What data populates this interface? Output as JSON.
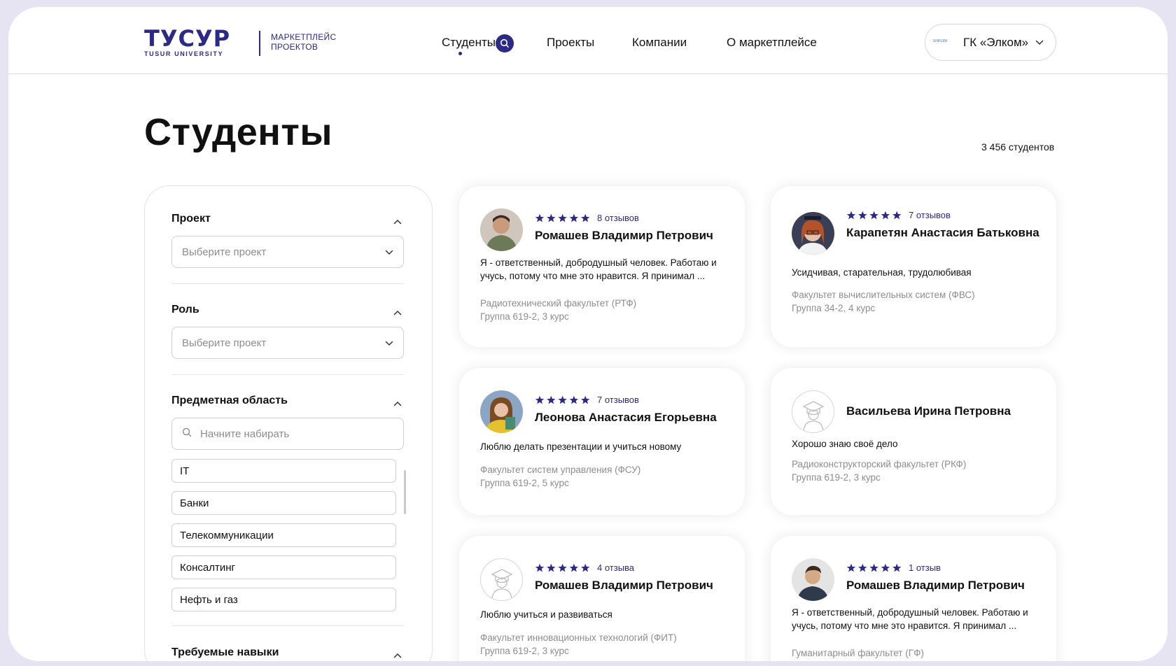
{
  "header": {
    "logo_main": "ТУСУР",
    "logo_sub": "TUSUR UNIVERSITY",
    "logo_tag_1": "Маркетплейс",
    "logo_tag_2": "проектов",
    "nav": [
      "Студенты",
      "Проекты",
      "Компании",
      "О маркетплейсе"
    ],
    "company_logo_text": "ЭЛКОМ",
    "company_name": "ГК «Элком»"
  },
  "page": {
    "title": "Студенты",
    "count": "3 456 студентов"
  },
  "filters": {
    "project_title": "Проект",
    "project_placeholder": "Выберите проект",
    "role_title": "Роль",
    "role_placeholder": "Выберите проект",
    "domain_title": "Предметная область",
    "domain_search_placeholder": "Начните набирать",
    "domain_options": [
      "IT",
      "Банки",
      "Телекоммуникации",
      "Консалтинг",
      "Нефть и газ"
    ],
    "skills_title": "Требуемые навыки"
  },
  "students": [
    {
      "rating": 5,
      "reviews": "8 отзывов",
      "name": "Ромашев Владимир Петрович",
      "desc": "Я - ответственный, добродушный человек. Работаю и учусь, потому что мне это нравится. Я принимал ...",
      "faculty": "Радиотехнический факультет (РТФ)",
      "group": "Группа 619-2, 3 курс",
      "avatar": "photo"
    },
    {
      "rating": 5,
      "reviews": "7 отзывов",
      "name": "Карапетян Анастасия Батьковна",
      "desc": "Усидчивая, старательная, трудолюбивая",
      "faculty": "Факультет вычислительных систем (ФВС)",
      "group": "Группа 34-2, 4 курс",
      "avatar": "photo"
    },
    {
      "rating": 5,
      "reviews": "7 отзывов",
      "name": "Леонова Анастасия Егорьевна",
      "desc": "Люблю делать презентации и учиться новому",
      "faculty": "Факультет систем управления (ФСУ)",
      "group": "Группа 619-2, 5 курс",
      "avatar": "photo"
    },
    {
      "rating": 0,
      "reviews": "",
      "name": "Васильева Ирина Петровна",
      "desc": "Хорошо знаю своё дело",
      "faculty": "Радиоконструкторский факультет (РКФ)",
      "group": "Группа 619-2, 3 курс",
      "avatar": "placeholder"
    },
    {
      "rating": 5,
      "reviews": "4 отзыва",
      "name": "Ромашев Владимир Петрович",
      "desc": "Люблю учиться и развиваться",
      "faculty": "Факультет инновационных технологий (ФИТ)",
      "group": "Группа 619-2, 3 курс",
      "avatar": "placeholder"
    },
    {
      "rating": 5,
      "reviews": "1 отзыв",
      "name": "Ромашев Владимир Петрович",
      "desc": "Я - ответственный, добродушный человек. Работаю и учусь, потому что мне это нравится. Я принимал ...",
      "faculty": "Гуманитарный факультет (ГФ)",
      "group": "",
      "avatar": "photo"
    }
  ],
  "colors": {
    "accent": "#2d2a86",
    "muted": "#8d8d8d",
    "frame": "#e6e4f2"
  },
  "icons": {
    "nav_badge": "search-icon",
    "chevron": "chevron-down-icon",
    "star": "star-icon",
    "avatar_placeholder": "graduate-placeholder-icon"
  }
}
